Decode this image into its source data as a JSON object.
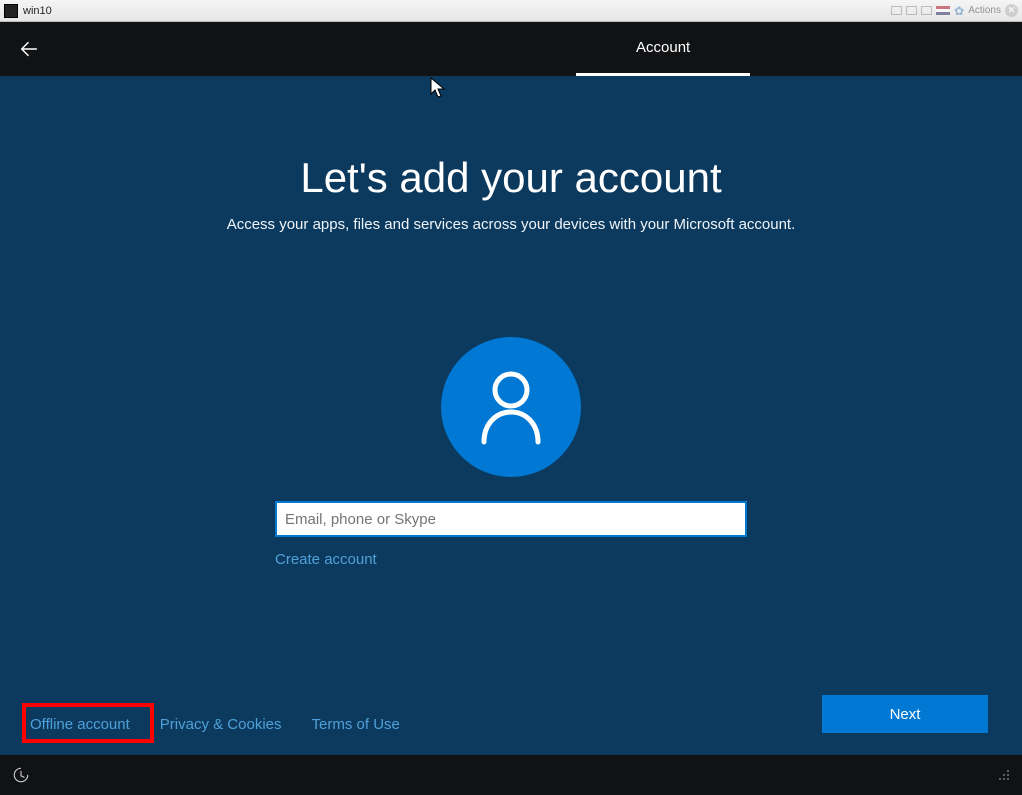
{
  "vm": {
    "title": "win10",
    "actions_label": "Actions"
  },
  "header": {
    "tab_label": "Account"
  },
  "main": {
    "heading": "Let's add your account",
    "subheading": "Access your apps, files and services across your devices with your Microsoft account.",
    "email_placeholder": "Email, phone or Skype",
    "create_account_label": "Create account"
  },
  "footer": {
    "offline_label": "Offline account",
    "privacy_label": "Privacy & Cookies",
    "terms_label": "Terms of Use",
    "next_label": "Next"
  }
}
